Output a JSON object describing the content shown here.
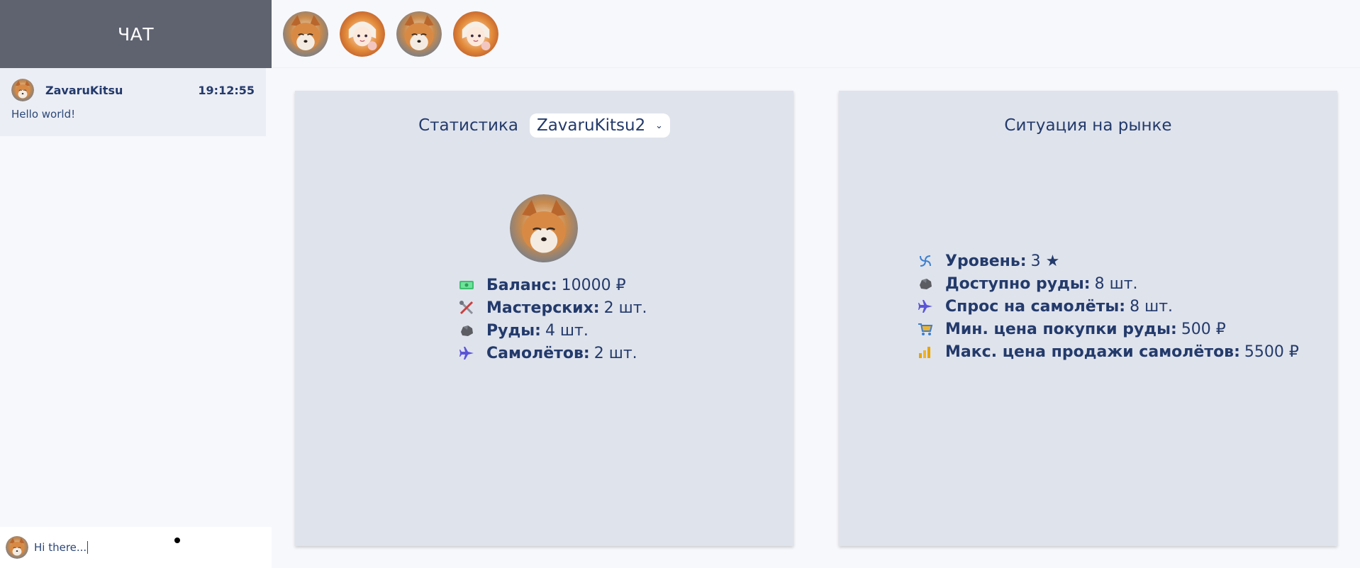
{
  "chat": {
    "title": "ЧАТ",
    "messages": [
      {
        "user": "ZavaruKitsu",
        "time": "19:12:55",
        "text": "Hello world!"
      }
    ],
    "composer": {
      "value": "Hi there..."
    }
  },
  "top_avatars": [
    "fox-avatar",
    "anime-girl-avatar",
    "fox-avatar",
    "anime-girl-avatar"
  ],
  "stats": {
    "title": "Статистика",
    "selected_player": "ZavaruKitsu2",
    "rows": [
      {
        "icon": "money-icon",
        "label": "Баланс:",
        "value": "10000 ₽"
      },
      {
        "icon": "tools-icon",
        "label": "Мастерских:",
        "value": "2 шт."
      },
      {
        "icon": "ore-icon",
        "label": "Руды:",
        "value": "4 шт."
      },
      {
        "icon": "airplane-icon",
        "label": "Самолётов:",
        "value": "2 шт."
      }
    ]
  },
  "market": {
    "title": "Ситуация на рынке",
    "rows": [
      {
        "icon": "cyclone-icon",
        "label": "Уровень:",
        "value": "3 ★"
      },
      {
        "icon": "ore-icon",
        "label": "Доступно руды:",
        "value": "8 шт."
      },
      {
        "icon": "airplane-icon",
        "label": "Спрос на самолёты:",
        "value": "8 шт."
      },
      {
        "icon": "cart-icon",
        "label": "Мин. цена покупки руды:",
        "value": "500 ₽"
      },
      {
        "icon": "chart-bars-icon",
        "label": "Макс. цена продажи самолётов:",
        "value": "5500 ₽"
      }
    ]
  },
  "colors": {
    "sidebar_header": "#5f6370",
    "card_bg": "#dfe3ec",
    "text": "#233a6b",
    "page_bg": "#f7f8fc"
  }
}
